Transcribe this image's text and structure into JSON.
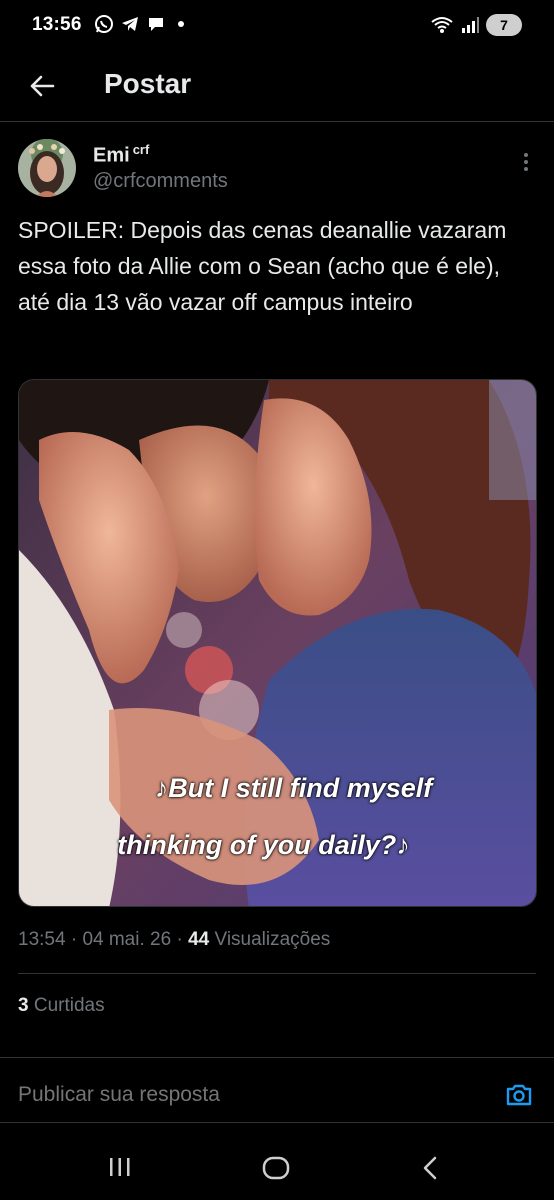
{
  "status_bar": {
    "time": "13:56",
    "battery": "7",
    "icons": [
      "whatsapp-icon",
      "telegram-icon",
      "chat-icon",
      "wifi-icon",
      "signal-icon",
      "battery-icon"
    ]
  },
  "header": {
    "title": "Postar"
  },
  "post": {
    "author_name": "Emi",
    "author_sup": "crf",
    "author_handle": "@crfcomments",
    "text": "SPOILER: Depois das cenas deanallie vazaram essa foto da Allie com o Sean (acho que é ele), até dia 13 vão vazar off campus inteiro",
    "image_caption_line1": "♪But I still find myself",
    "image_caption_line2": "thinking of you daily?♪",
    "time": "13:54",
    "date": "04 mai. 26",
    "views_count": "44",
    "views_label": "Visualizações",
    "likes_count": "3",
    "likes_label": "Curtidas"
  },
  "reply": {
    "placeholder": "Publicar sua resposta"
  },
  "colors": {
    "background": "#000000",
    "text_primary": "#e7e9ea",
    "text_secondary": "#71767b",
    "divider": "#2f3336",
    "accent": "#1d9bf0"
  }
}
